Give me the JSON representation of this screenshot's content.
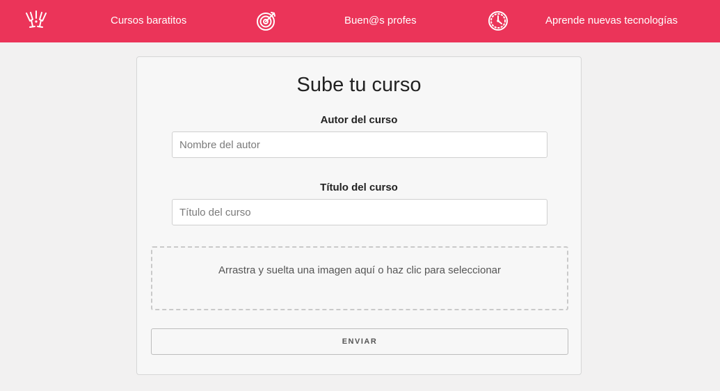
{
  "colors": {
    "accent": "#eb3459",
    "page_background": "#f2f1f1",
    "card_background": "#f7f7f7"
  },
  "nav": {
    "items": [
      {
        "icon": "cheers-glasses-icon",
        "label": "Cursos baratitos"
      },
      {
        "icon": "target-icon",
        "label": "Buen@s profes"
      },
      {
        "icon": "clock-icon",
        "label": "Aprende nuevas tecnologías"
      }
    ]
  },
  "form": {
    "title": "Sube tu curso",
    "author": {
      "label": "Autor del curso",
      "placeholder": "Nombre del autor",
      "value": ""
    },
    "course_title": {
      "label": "Título del curso",
      "placeholder": "Título del curso",
      "value": ""
    },
    "dropzone": {
      "text": "Arrastra y suelta una imagen aquí o haz clic para seleccionar"
    },
    "submit_label": "ENVIAR"
  }
}
